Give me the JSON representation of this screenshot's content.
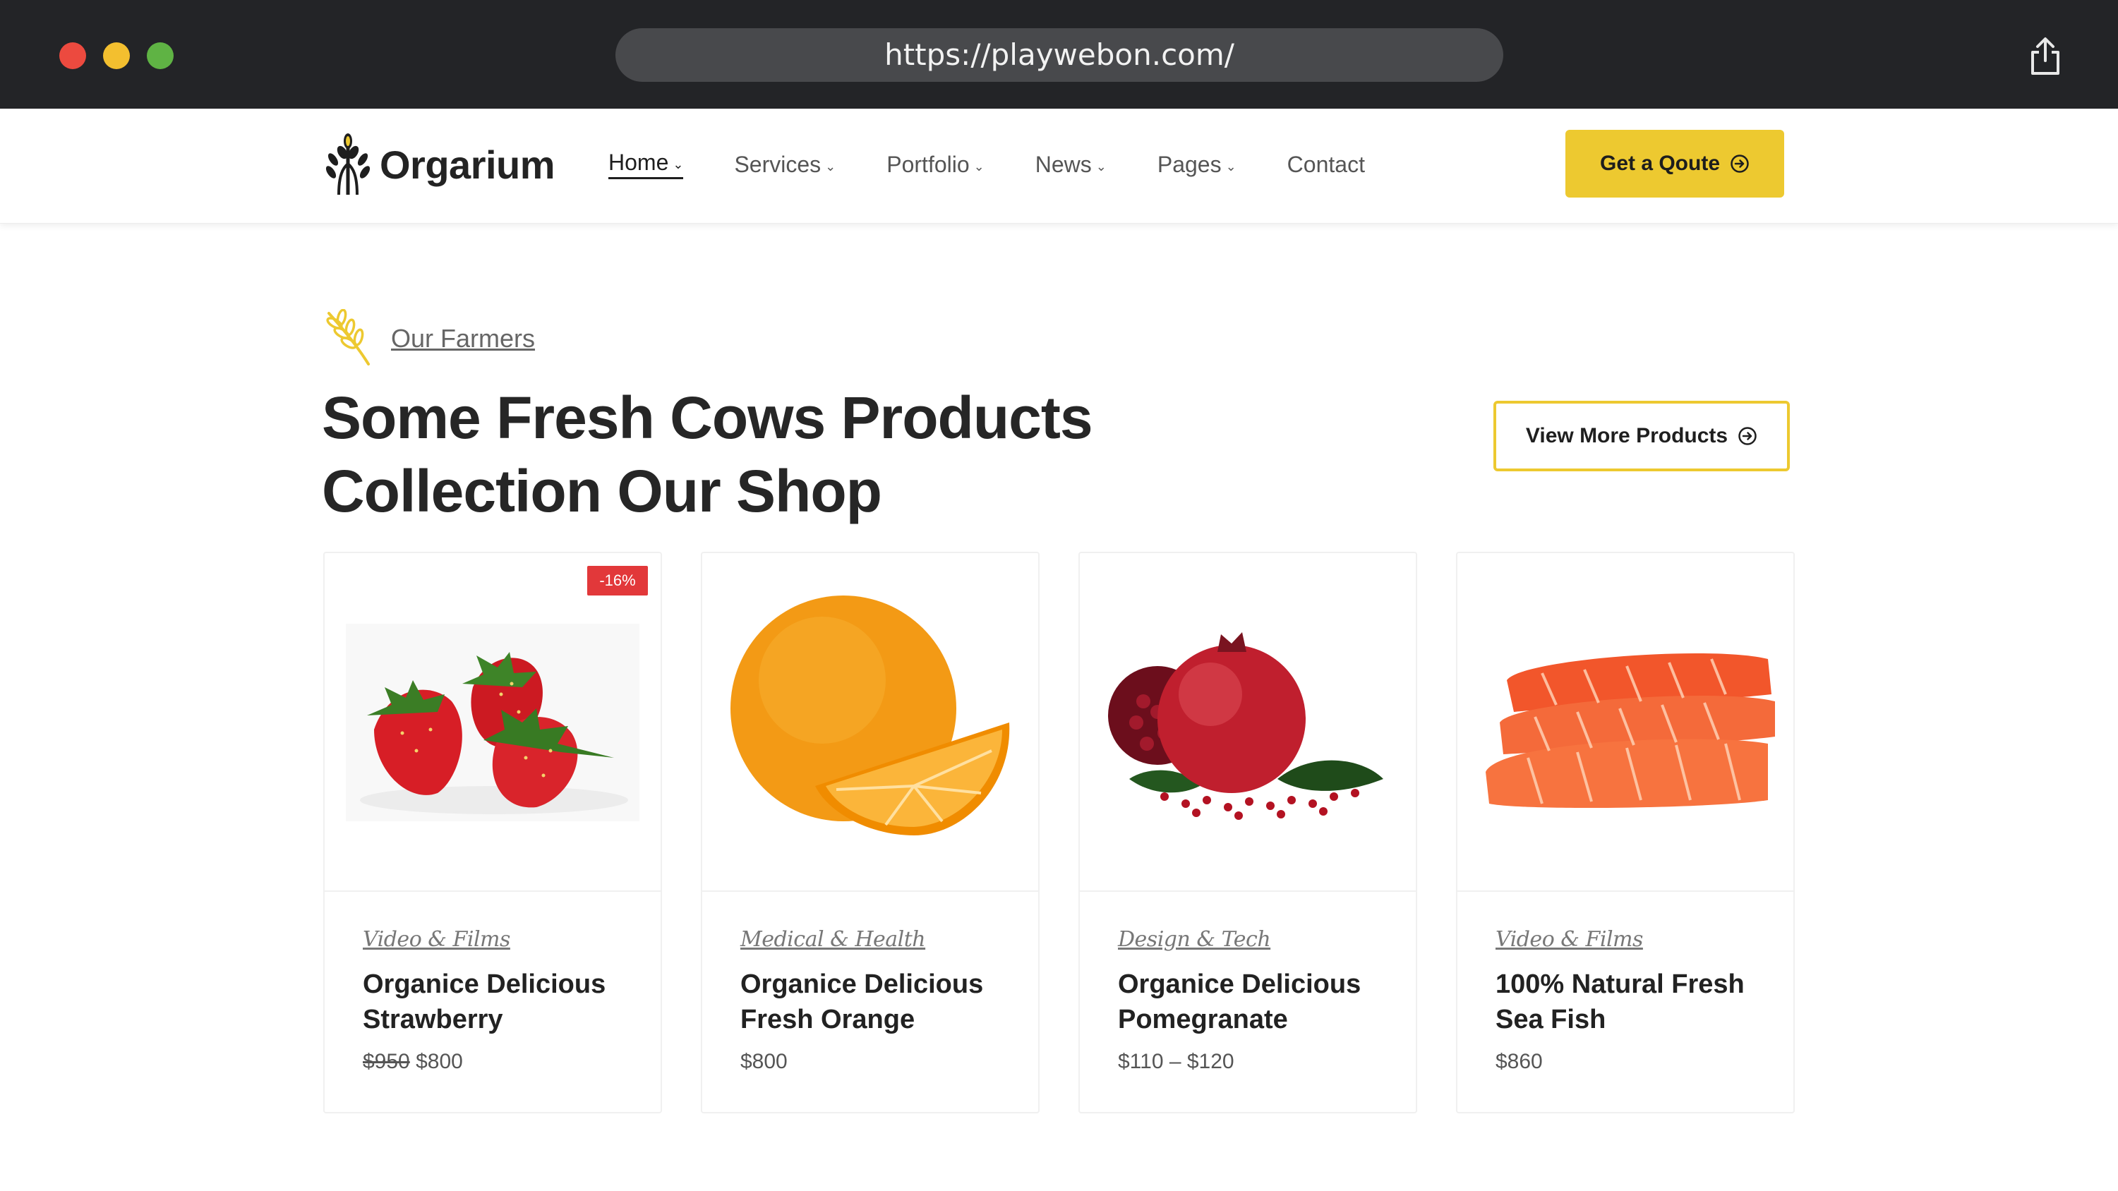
{
  "browser": {
    "url": "https://playwebon.com/",
    "icons": [
      "close-dot",
      "minimize-dot",
      "maximize-dot",
      "share-icon"
    ]
  },
  "header": {
    "brand": "Orgarium",
    "nav": [
      {
        "label": "Home",
        "dropdown": true,
        "active": true
      },
      {
        "label": "Services",
        "dropdown": true
      },
      {
        "label": "Portfolio",
        "dropdown": true
      },
      {
        "label": "News",
        "dropdown": true
      },
      {
        "label": "Pages",
        "dropdown": true
      },
      {
        "label": "Contact",
        "dropdown": false
      }
    ],
    "cta_label": "Get a Qoute"
  },
  "section": {
    "eyebrow": "Our Farmers",
    "title_line1": "Some Fresh Cows Products",
    "title_line2": "Collection Our Shop",
    "view_more_label": "View More Products"
  },
  "products": [
    {
      "category": "Video & Films",
      "title": "Organice Delicious Strawberry",
      "old_price": "$950",
      "price": "$800",
      "badge": "-16%",
      "image": "strawberry"
    },
    {
      "category": "Medical & Health",
      "title": "Organice Delicious Fresh Orange",
      "old_price": "",
      "price": "$800",
      "badge": "",
      "image": "orange"
    },
    {
      "category": "Design & Tech",
      "title": "Organice Delicious Pomegranate",
      "old_price": "",
      "price": "$110 – $120",
      "badge": "",
      "image": "pomegranate"
    },
    {
      "category": "Video & Films",
      "title": "100% Natural Fresh Sea Fish",
      "old_price": "",
      "price": "$860",
      "badge": "",
      "image": "salmon"
    }
  ],
  "colors": {
    "accent": "#edc930",
    "chrome": "#232427",
    "sale_badge": "#e2383a",
    "heading": "#262626"
  }
}
